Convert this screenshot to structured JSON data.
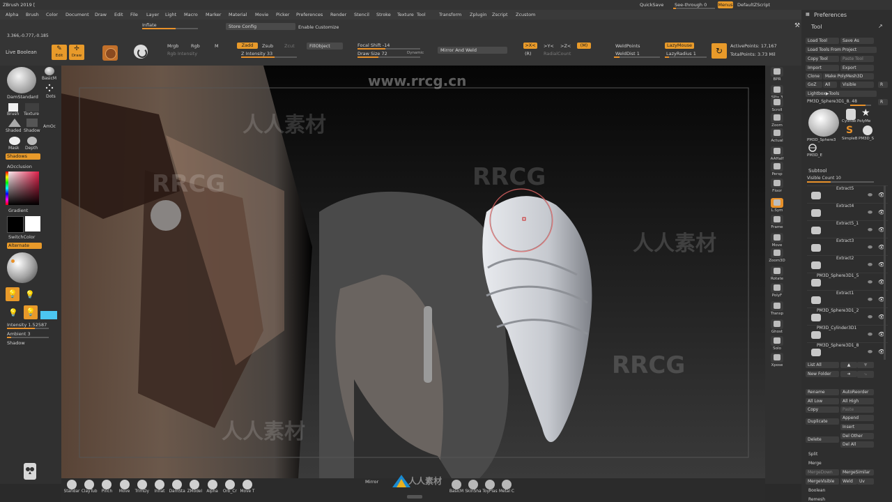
{
  "app": {
    "title": "ZBrush 2019 ["
  },
  "menu": [
    "Alpha",
    "Brush",
    "Color",
    "Document",
    "Draw",
    "Edit",
    "File",
    "Layer",
    "Light",
    "Macro",
    "Marker",
    "Material",
    "Movie",
    "Picker",
    "Preferences",
    "Render",
    "Stencil",
    "Stroke",
    "Texture",
    "Tool",
    "Transform",
    "Zplugin",
    "Zscript",
    "Zcustom"
  ],
  "titlebar": {
    "quicksave": "QuickSave",
    "seethrough": "See-through 0",
    "menus": "Menus",
    "defaultscript": "DefaultZScript",
    "coord": "3.366,-0.777,-0.185"
  },
  "top": {
    "inflate": "Inflate",
    "store_config": "Store Config",
    "enable_customize": "Enable Customize",
    "live_boolean": "Live Boolean",
    "edit": "Edit",
    "draw": "Draw",
    "mrgb": "Mrgb",
    "rgb": "Rgb",
    "m": "M",
    "rgb_intensity": "Rgb Intensity",
    "zadd": "Zadd",
    "zsub": "Zsub",
    "zcut": "Zcut",
    "z_intensity": "Z Intensity 33",
    "fillobject": "FillObject",
    "focal_shift": "Focal Shift -14",
    "draw_size": "Draw Size 72",
    "dynamic": "Dynamic",
    "mirror_weld": "Mirror And Weld",
    "x": ">X<",
    "y": ">Y<",
    "z": ">Z<",
    "mz": "(M)",
    "r": "(R)",
    "radial_count": "RadialCount",
    "weld_points": "WeldPoints",
    "weld_dist": "WeldDist 1",
    "lazy_mouse": "LazyMouse",
    "lazy_radius": "LazyRadius 1",
    "active_points": "ActivePoints: 17,167",
    "total_points": "TotalPoints: 3.73 Mil"
  },
  "left": {
    "brush": "DamStandard",
    "brush2": "BasicM",
    "dots": "Dots",
    "brush_lbl": "Brush",
    "texture": "Texture",
    "shaded": "Shaded",
    "shadow": "Shadow",
    "amoc": "AmOc",
    "mask": "Mask",
    "depth": "Depth",
    "shadows": "Shadows",
    "aocclusion": "AOcclusion",
    "gradient": "Gradient",
    "switchcolor": "SwitchColor",
    "alternate": "Alternate",
    "intensity": "Intensity 1.52587",
    "ambient": "Ambient 3",
    "shadow2": "Shadow"
  },
  "right": [
    "BPR",
    "SPix 3",
    "Scroll",
    "Zoom",
    "Actual",
    "AAHalf",
    "Persp",
    "Floor",
    "L.Sym",
    "Frame",
    "Move",
    "Zoom3D",
    "Rotate",
    "PolyF",
    "Transp",
    "Ghost",
    "Solo",
    "Xpose"
  ],
  "toolpanel": {
    "preferences": "Preferences",
    "tool": "Tool",
    "load_tool": "Load Tool",
    "save_as": "Save As",
    "load_from_project": "Load Tools From Project",
    "copy_tool": "Copy Tool",
    "paste_tool": "Paste Tool",
    "import": "Import",
    "export": "Export",
    "clone": "Clone",
    "make_polymesh": "Make PolyMesh3D",
    "goz": "GoZ",
    "all": "All",
    "visible": "Visible",
    "r": "R",
    "lightbox_tools": "Lightbox▶Tools",
    "current_tool": "PM3D_Sphere3D1_8. 48",
    "thumbs": [
      "PM3D_Sphere3",
      "Cylinde",
      "PolyMe",
      "SimpleB",
      "PM3D_S",
      "PM3D_E"
    ],
    "subtool": "Subtool",
    "visible_count": "Visible Count 10",
    "subtools": [
      "Extract5",
      "Extract4",
      "Extract5_1",
      "Extract3",
      "Extract2",
      "PM3D_Sphere3D1_5",
      "Extract1",
      "PM3D_Sphere3D1_2",
      "PM3D_Cylinder3D1",
      "PM3D_Sphere3D1_8"
    ],
    "list_all": "List All",
    "new_folder": "New Folder",
    "rename": "Rename",
    "autoreorder": "AutoReorder",
    "all_low": "All Low",
    "all_high": "All High",
    "copy": "Copy",
    "paste": "Paste",
    "duplicate": "Duplicate",
    "append": "Append",
    "insert": "Insert",
    "delete": "Delete",
    "del_other": "Del Other",
    "del_all": "Del All",
    "split": "Split",
    "merge": "Merge",
    "merge_down": "MergeDown",
    "merge_similar": "MergeSimilar",
    "merge_visible": "MergeVisible",
    "weld": "Weld",
    "uv": "Uv",
    "boolean": "Boolean",
    "remesh": "Remesh"
  },
  "bottom": {
    "brushes": [
      "Standar",
      "ClayTub",
      "Pinch",
      "Move",
      "TrimDy",
      "Inflat",
      "DamSta",
      "ZModel",
      "Alpha",
      "Orb_Cr",
      "Move T"
    ],
    "mirror": "Mirror",
    "brushes2": [
      "BasicM",
      "SkinSha",
      "ToyPlas",
      "Metal C"
    ]
  },
  "watermarks": [
    "www.rrcg.cn",
    "RRCG",
    "人人素材"
  ],
  "colors": {
    "accent": "#e8912a",
    "panel": "#2e2e2e",
    "canvas": "#000000"
  }
}
